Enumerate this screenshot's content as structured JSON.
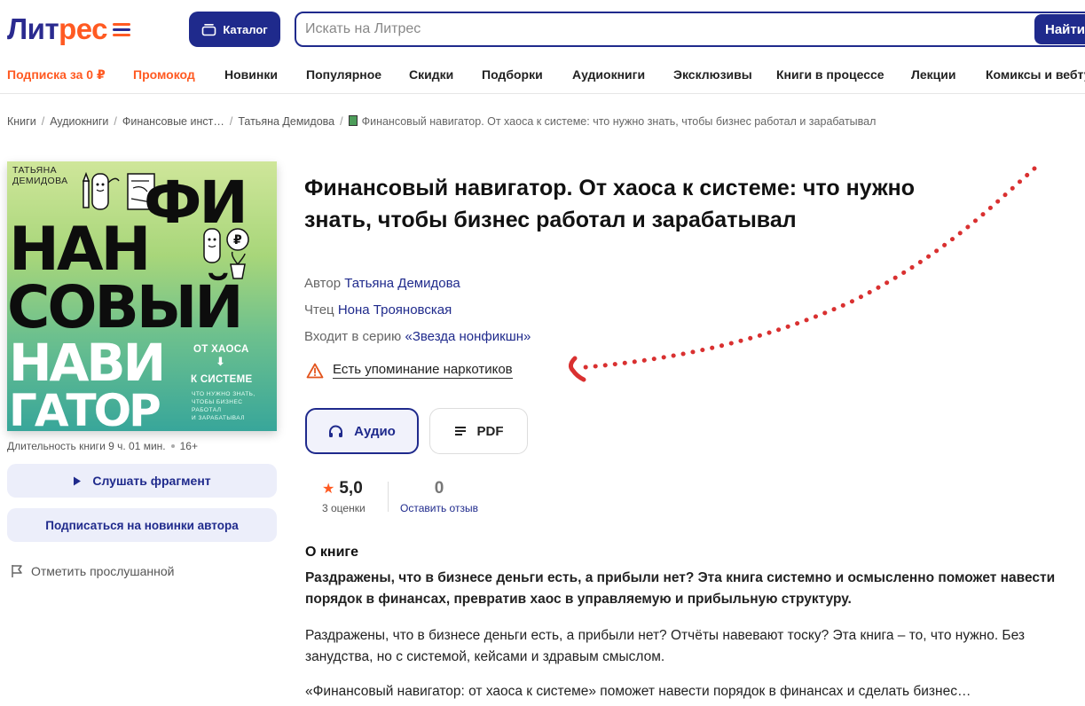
{
  "header": {
    "logo_part1": "Лит",
    "logo_part2": "рес",
    "catalog_label": "Каталог",
    "search_placeholder": "Искать на Литрес",
    "search_button": "Найти"
  },
  "nav": {
    "items": [
      {
        "label": "Подписка за 0 ₽",
        "accent": true
      },
      {
        "label": "Промокод",
        "accent": true
      },
      {
        "label": "Новинки",
        "accent": false
      },
      {
        "label": "Популярное",
        "accent": false
      },
      {
        "label": "Скидки",
        "accent": false
      },
      {
        "label": "Подборки",
        "accent": false
      },
      {
        "label": "Аудиокниги",
        "accent": false
      },
      {
        "label": "Эксклюзивы",
        "accent": false
      },
      {
        "label": "Книги в процессе",
        "accent": false
      },
      {
        "label": "Лекции",
        "accent": false
      },
      {
        "label": "Комиксы и вебту",
        "accent": false
      }
    ]
  },
  "breadcrumb": {
    "items": [
      "Книги",
      "Аудиокниги",
      "Финансовые инст…",
      "Татьяна Демидова"
    ],
    "current": "Финансовый навигатор. От хаоса к системе: что нужно знать, чтобы бизнес работал и зарабатывал"
  },
  "cover": {
    "author_line1": "ТАТЬЯНА",
    "author_line2": "ДЕМИДОВА",
    "word1": "ФИ",
    "word2": "НАН",
    "word3": "СОВЫЙ",
    "word4": "НАВИ",
    "word5": "ГАТОР",
    "sub1": "ОТ ХАОСА",
    "sub2": "К СИСТЕМЕ",
    "arrow_glyph": "⬇",
    "tiny1": "ЧТО НУЖНО ЗНАТЬ,",
    "tiny2": "ЧТОБЫ БИЗНЕС",
    "tiny3": "РАБОТАЛ",
    "tiny4": "И ЗАРАБАТЫВАЛ"
  },
  "left": {
    "duration": "Длительность книги 9 ч. 01 мин.",
    "age": "16+",
    "listen_button": "Слушать фрагмент",
    "subscribe_button": "Подписаться на новинки автора",
    "mark_listened": "Отметить прослушанной"
  },
  "book": {
    "title": "Финансовый навигатор. От хаоса к системе: что нужно знать, чтобы бизнес работал и зарабатывал",
    "author_label": "Автор",
    "author": "Татьяна Демидова",
    "reader_label": "Чтец",
    "reader": "Нона Трояновская",
    "series_label": "Входит в серию",
    "series": "«Звезда нонфикшн»",
    "warning": "Есть упоминание наркотиков"
  },
  "formats": {
    "audio": "Аудио",
    "pdf": "PDF"
  },
  "rating": {
    "value": "5,0",
    "count": "3 оценки",
    "reviews_num": "0",
    "reviews_link": "Оставить отзыв"
  },
  "about": {
    "heading": "О книге",
    "p1": "Раздражены, что в бизнесе деньги есть, а прибыли нет? Эта книга системно и осмысленно поможет навести порядок в финансах, превратив хаос в управляемую и прибыльную структуру.",
    "p2": "Раздражены, что в бизнесе деньги есть, а прибыли нет? Отчёты навевают тоску? Эта книга – то, что нужно. Без занудства, но с системой, кейсами и здравым смыслом.",
    "p3": "«Финансовый навигатор: от хаоса к системе» поможет навести порядок в финансах и сделать бизнес…"
  },
  "colors": {
    "brand_blue": "#1f2a8c",
    "brand_orange": "#ff5a22",
    "annotation_red": "#d93030"
  }
}
